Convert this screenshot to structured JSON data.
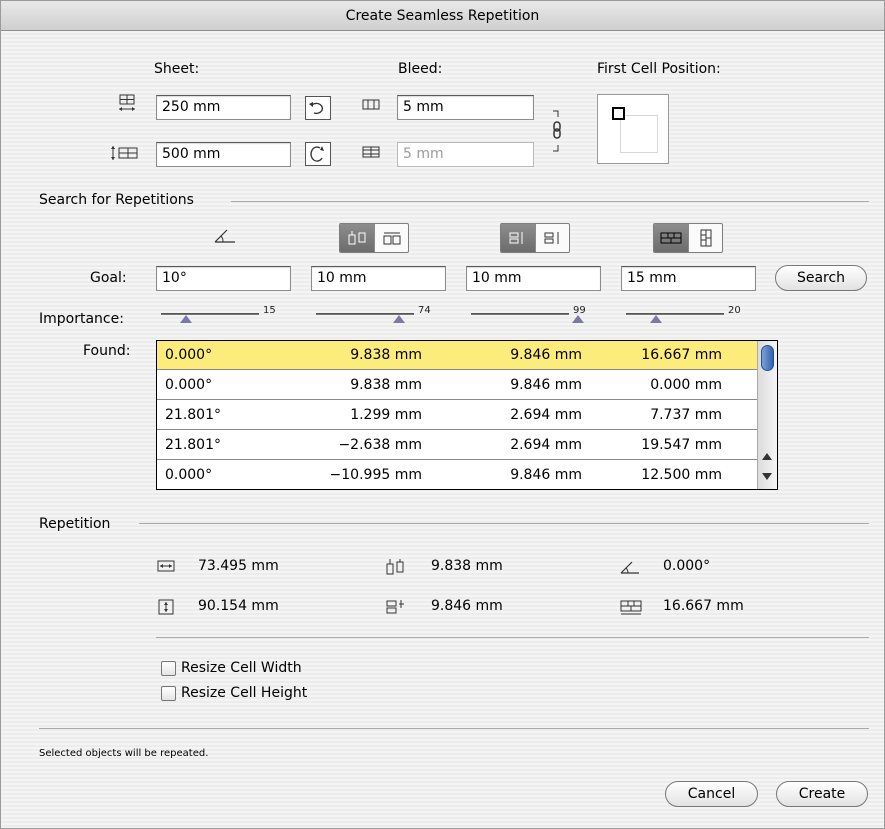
{
  "window": {
    "title": "Create Seamless Repetition"
  },
  "sheet": {
    "label": "Sheet:",
    "width": "250 mm",
    "height": "500 mm",
    "width_icon": "sheet-width-icon",
    "height_icon": "sheet-height-icon"
  },
  "bleed": {
    "label": "Bleed:",
    "horizontal": "5 mm",
    "vertical": "5 mm",
    "link_icon": "chain-link-icon"
  },
  "first_cell": {
    "label": "First Cell Position:"
  },
  "search": {
    "section_label": "Search for Repetitions",
    "goal_label": "Goal:",
    "importance_label": "Importance:",
    "found_label": "Found:",
    "search_button": "Search",
    "goals": [
      "10°",
      "10 mm",
      "10 mm",
      "15 mm"
    ],
    "importance": [
      15,
      74,
      99,
      20
    ],
    "rows": [
      [
        "0.000°",
        "9.838 mm",
        "9.846 mm",
        "16.667 mm"
      ],
      [
        "0.000°",
        "9.838 mm",
        "9.846 mm",
        "0.000 mm"
      ],
      [
        "21.801°",
        "1.299 mm",
        "2.694 mm",
        "7.737 mm"
      ],
      [
        "21.801°",
        "−2.638 mm",
        "2.694 mm",
        "19.547 mm"
      ],
      [
        "0.000°",
        "−10.995 mm",
        "9.846 mm",
        "12.500 mm"
      ]
    ]
  },
  "repetition": {
    "section_label": "Repetition",
    "width": "73.495 mm",
    "height": "90.154 mm",
    "offset_v": "9.838 mm",
    "offset_h": "9.846 mm",
    "angle": "0.000°",
    "shift": "16.667 mm",
    "resize_width": "Resize Cell Width",
    "resize_height": "Resize Cell Height"
  },
  "footer": {
    "note": "Selected objects will be repeated.",
    "cancel": "Cancel",
    "create": "Create"
  },
  "colors": {
    "selected_row": "#fbec7c",
    "scroll_thumb": "#2f63b3"
  }
}
